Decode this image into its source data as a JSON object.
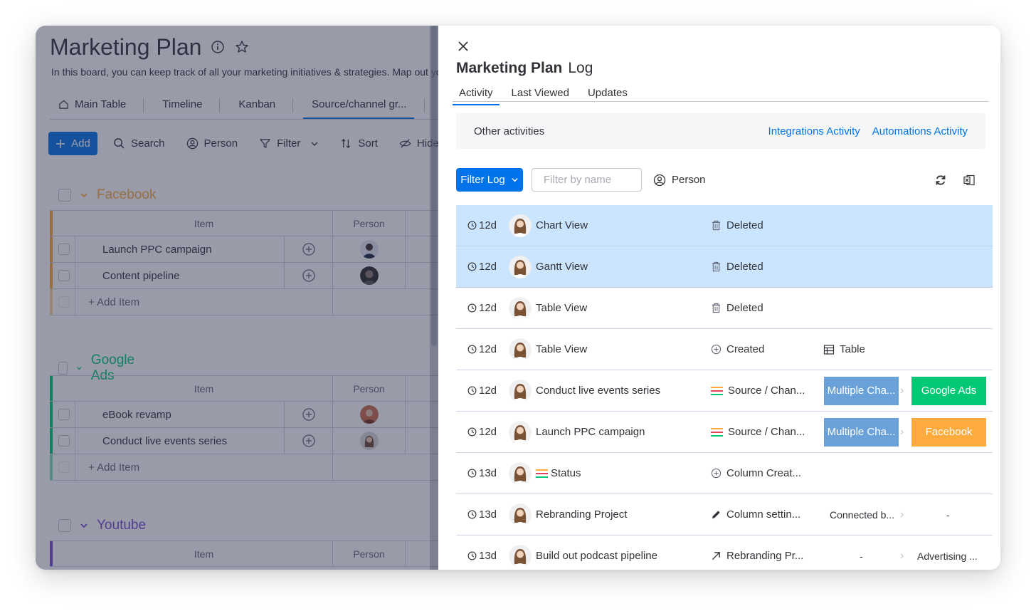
{
  "board": {
    "title": "Marketing Plan",
    "description": "In this board, you can keep track of all your marketing initiatives & strategies. Map out your",
    "views": [
      "Main Table",
      "Timeline",
      "Kanban",
      "Source/channel gr..."
    ],
    "toolbar": {
      "add": "Add",
      "search": "Search",
      "person": "Person",
      "filter": "Filter",
      "sort": "Sort",
      "hide": "Hide"
    },
    "column_item": "Item",
    "column_person": "Person",
    "add_item": "+ Add Item",
    "groups": [
      {
        "name": "Facebook",
        "color": "#fdab3d",
        "items": [
          "Launch PPC campaign",
          "Content pipeline"
        ]
      },
      {
        "name": "Google Ads",
        "color": "#00c875",
        "items": [
          "eBook revamp",
          "Conduct live events series"
        ]
      },
      {
        "name": "Youtube",
        "color": "#784bd1",
        "items": []
      }
    ]
  },
  "panel": {
    "title": "Marketing Plan",
    "title_suffix": "Log",
    "tabs": [
      "Activity",
      "Last Viewed",
      "Updates"
    ],
    "other_activities": "Other activities",
    "integrations_link": "Integrations Activity",
    "automations_link": "Automations Activity",
    "filter_log": "Filter Log",
    "filter_placeholder": "Filter by name",
    "person_filter": "Person",
    "rows": [
      {
        "time": "12d",
        "name": "Chart View",
        "action": "Deleted",
        "action_icon": "trash-icon",
        "highlight": true
      },
      {
        "time": "12d",
        "name": "Gantt View",
        "action": "Deleted",
        "action_icon": "trash-icon",
        "highlight": true
      },
      {
        "time": "12d",
        "name": "Table View",
        "action": "Deleted",
        "action_icon": "trash-icon"
      },
      {
        "time": "12d",
        "name": "Table View",
        "action": "Created",
        "action_icon": "plus-circle-icon",
        "from": "Table",
        "from_icon": "table-icon"
      },
      {
        "time": "12d",
        "name": "Conduct live events series",
        "action": "Source / Chan...",
        "action_icon": "status-lines-icon",
        "from_chip": "Multiple Cha...",
        "to_chip": "Google Ads"
      },
      {
        "time": "12d",
        "name": "Launch PPC campaign",
        "action": "Source / Chan...",
        "action_icon": "status-lines-icon",
        "from_chip": "Multiple Cha...",
        "to_chip": "Facebook"
      },
      {
        "time": "13d",
        "name": "Status",
        "action": "Column Creat...",
        "action_icon": "plus-circle-icon",
        "name_icon": "status-lines-icon"
      },
      {
        "time": "13d",
        "name": "Rebranding Project",
        "action": "Column settin...",
        "action_icon": "pencil-icon",
        "from_text": "Connected b...",
        "to_text": "-"
      },
      {
        "time": "13d",
        "name": "Build out podcast pipeline",
        "action": "Rebranding Pr...",
        "action_icon": "arrow-up-right-icon",
        "from_text": "-",
        "to_text": "Advertising ..."
      }
    ]
  },
  "colors": {
    "primary": "#0073ea",
    "highlight_row": "#cce5ff",
    "chip_from": "#579bfc",
    "chip_google_ads": "#00c875",
    "chip_facebook": "#fdab3d",
    "status_lines": [
      "#fdab3d",
      "#e2445c",
      "#00c875"
    ]
  }
}
